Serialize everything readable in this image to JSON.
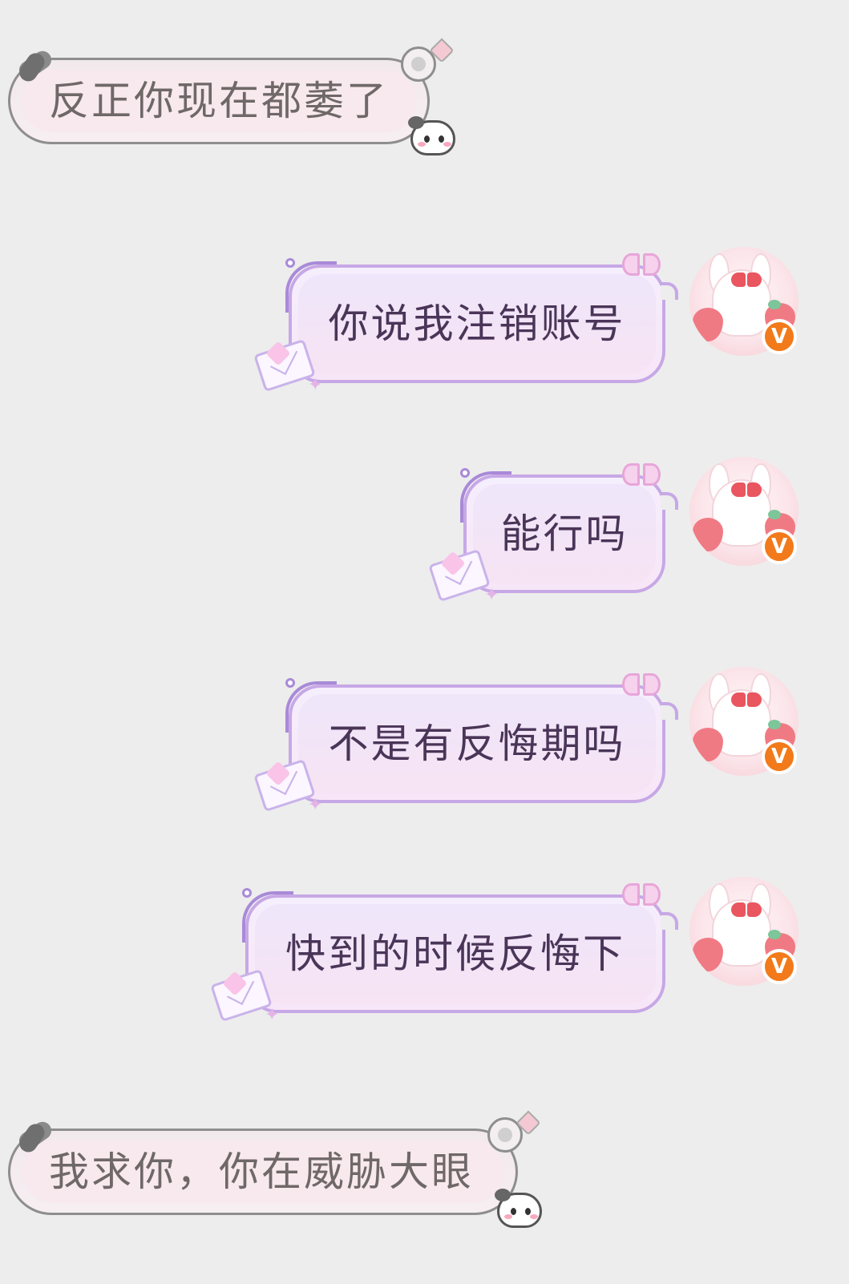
{
  "messages": [
    {
      "direction": "received",
      "text": "反正你现在都萎了"
    },
    {
      "direction": "sent",
      "text": "你说我注销账号"
    },
    {
      "direction": "sent",
      "text": "能行吗"
    },
    {
      "direction": "sent",
      "text": "不是有反悔期吗"
    },
    {
      "direction": "sent",
      "text": "快到的时候反悔下"
    },
    {
      "direction": "received",
      "text": "我求你，你在威胁大眼"
    }
  ],
  "avatar": {
    "badge_label": "V",
    "badge_color": "#f27a1a"
  },
  "colors": {
    "background": "#ededed",
    "sent_bubble_border": "#c7a8e6",
    "sent_text": "#4a3558",
    "received_bubble_border": "#8e8e8e",
    "received_text": "#6f6868"
  }
}
